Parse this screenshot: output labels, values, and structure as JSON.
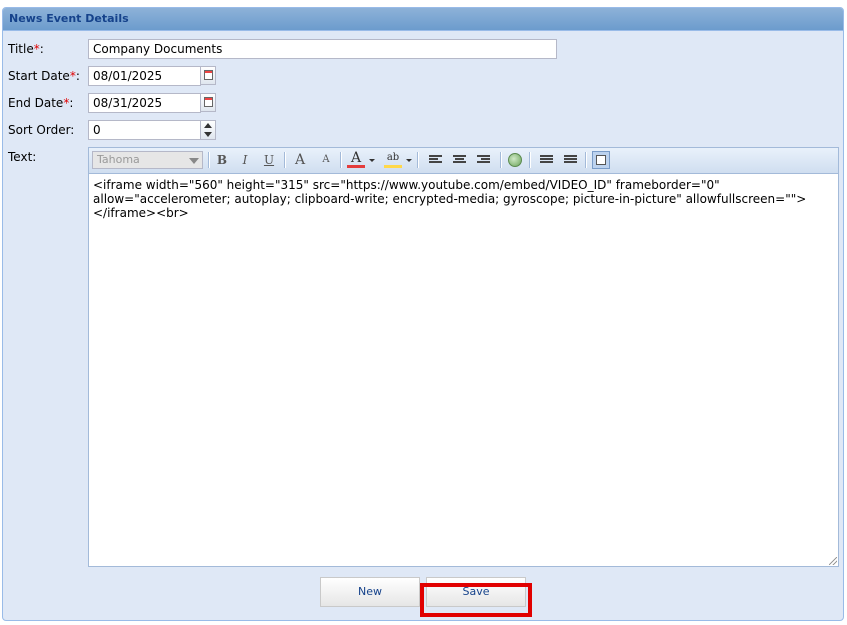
{
  "panel": {
    "title": "News Event Details"
  },
  "form": {
    "title_label": "Title",
    "title_value": "Company Documents",
    "start_label": "Start Date",
    "start_value": "08/01/2025",
    "end_label": "End Date",
    "end_value": "08/31/2025",
    "sort_label": "Sort Order:",
    "sort_value": "0",
    "text_label": "Text:",
    "required_mark": "*",
    "colon": ":"
  },
  "editor": {
    "font": "Tahoma",
    "content": "<iframe width=\"560\" height=\"315\" src=\"https://www.youtube.com/embed/VIDEO_ID\" frameborder=\"0\" allow=\"accelerometer; autoplay; clipboard-write; encrypted-media; gyroscope; picture-in-picture\" allowfullscreen=\"\"></iframe><br>",
    "toolbar": {
      "bold": "B",
      "italic": "I",
      "underline": "U",
      "grow": "A",
      "shrink": "A",
      "font_color": "A",
      "highlight": "ab"
    }
  },
  "buttons": {
    "new": "New",
    "save": "Save"
  },
  "colors": {
    "accent": "#15428b",
    "panel_bg": "#dfe8f6",
    "required": "#e00000",
    "highlight_box": "#e10000"
  }
}
